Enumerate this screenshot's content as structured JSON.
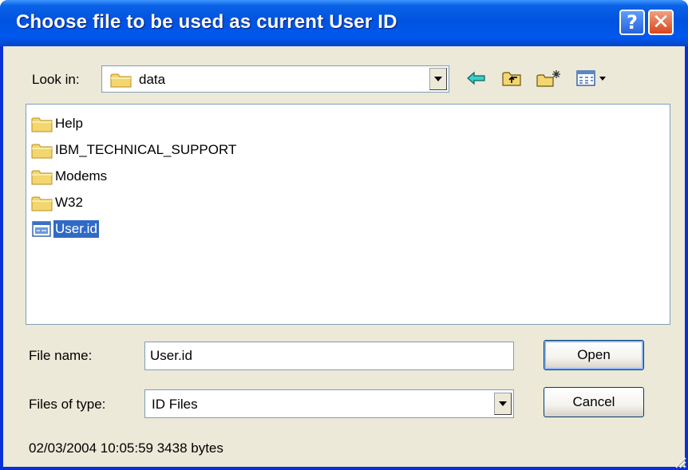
{
  "window": {
    "title": "Choose file to be used as current User ID",
    "help_glyph": "?",
    "close_glyph": "✕"
  },
  "look_in": {
    "label": "Look in:",
    "value": "data",
    "icon": "folder-icon"
  },
  "toolbar": {
    "icons": [
      "back-arrow-icon",
      "up-one-level-icon",
      "create-new-folder-icon",
      "view-menu-icon"
    ]
  },
  "files": [
    {
      "name": "Help",
      "icon": "folder-icon",
      "selected": false
    },
    {
      "name": "IBM_TECHNICAL_SUPPORT",
      "icon": "folder-icon",
      "selected": false
    },
    {
      "name": "Modems",
      "icon": "folder-icon",
      "selected": false
    },
    {
      "name": "W32",
      "icon": "folder-icon",
      "selected": false
    },
    {
      "name": "User.id",
      "icon": "id-file-icon",
      "selected": true
    }
  ],
  "file_name": {
    "label": "File name:",
    "value": "User.id"
  },
  "file_type": {
    "label": "Files of type:",
    "value": "ID Files"
  },
  "buttons": {
    "open": "Open",
    "cancel": "Cancel"
  },
  "status": "02/03/2004 10:05:59 3438 bytes",
  "colors": {
    "titlebar": "#0053e0",
    "dialog_bg": "#ece9d8",
    "selection": "#316ac5",
    "close_button": "#d8451e"
  }
}
